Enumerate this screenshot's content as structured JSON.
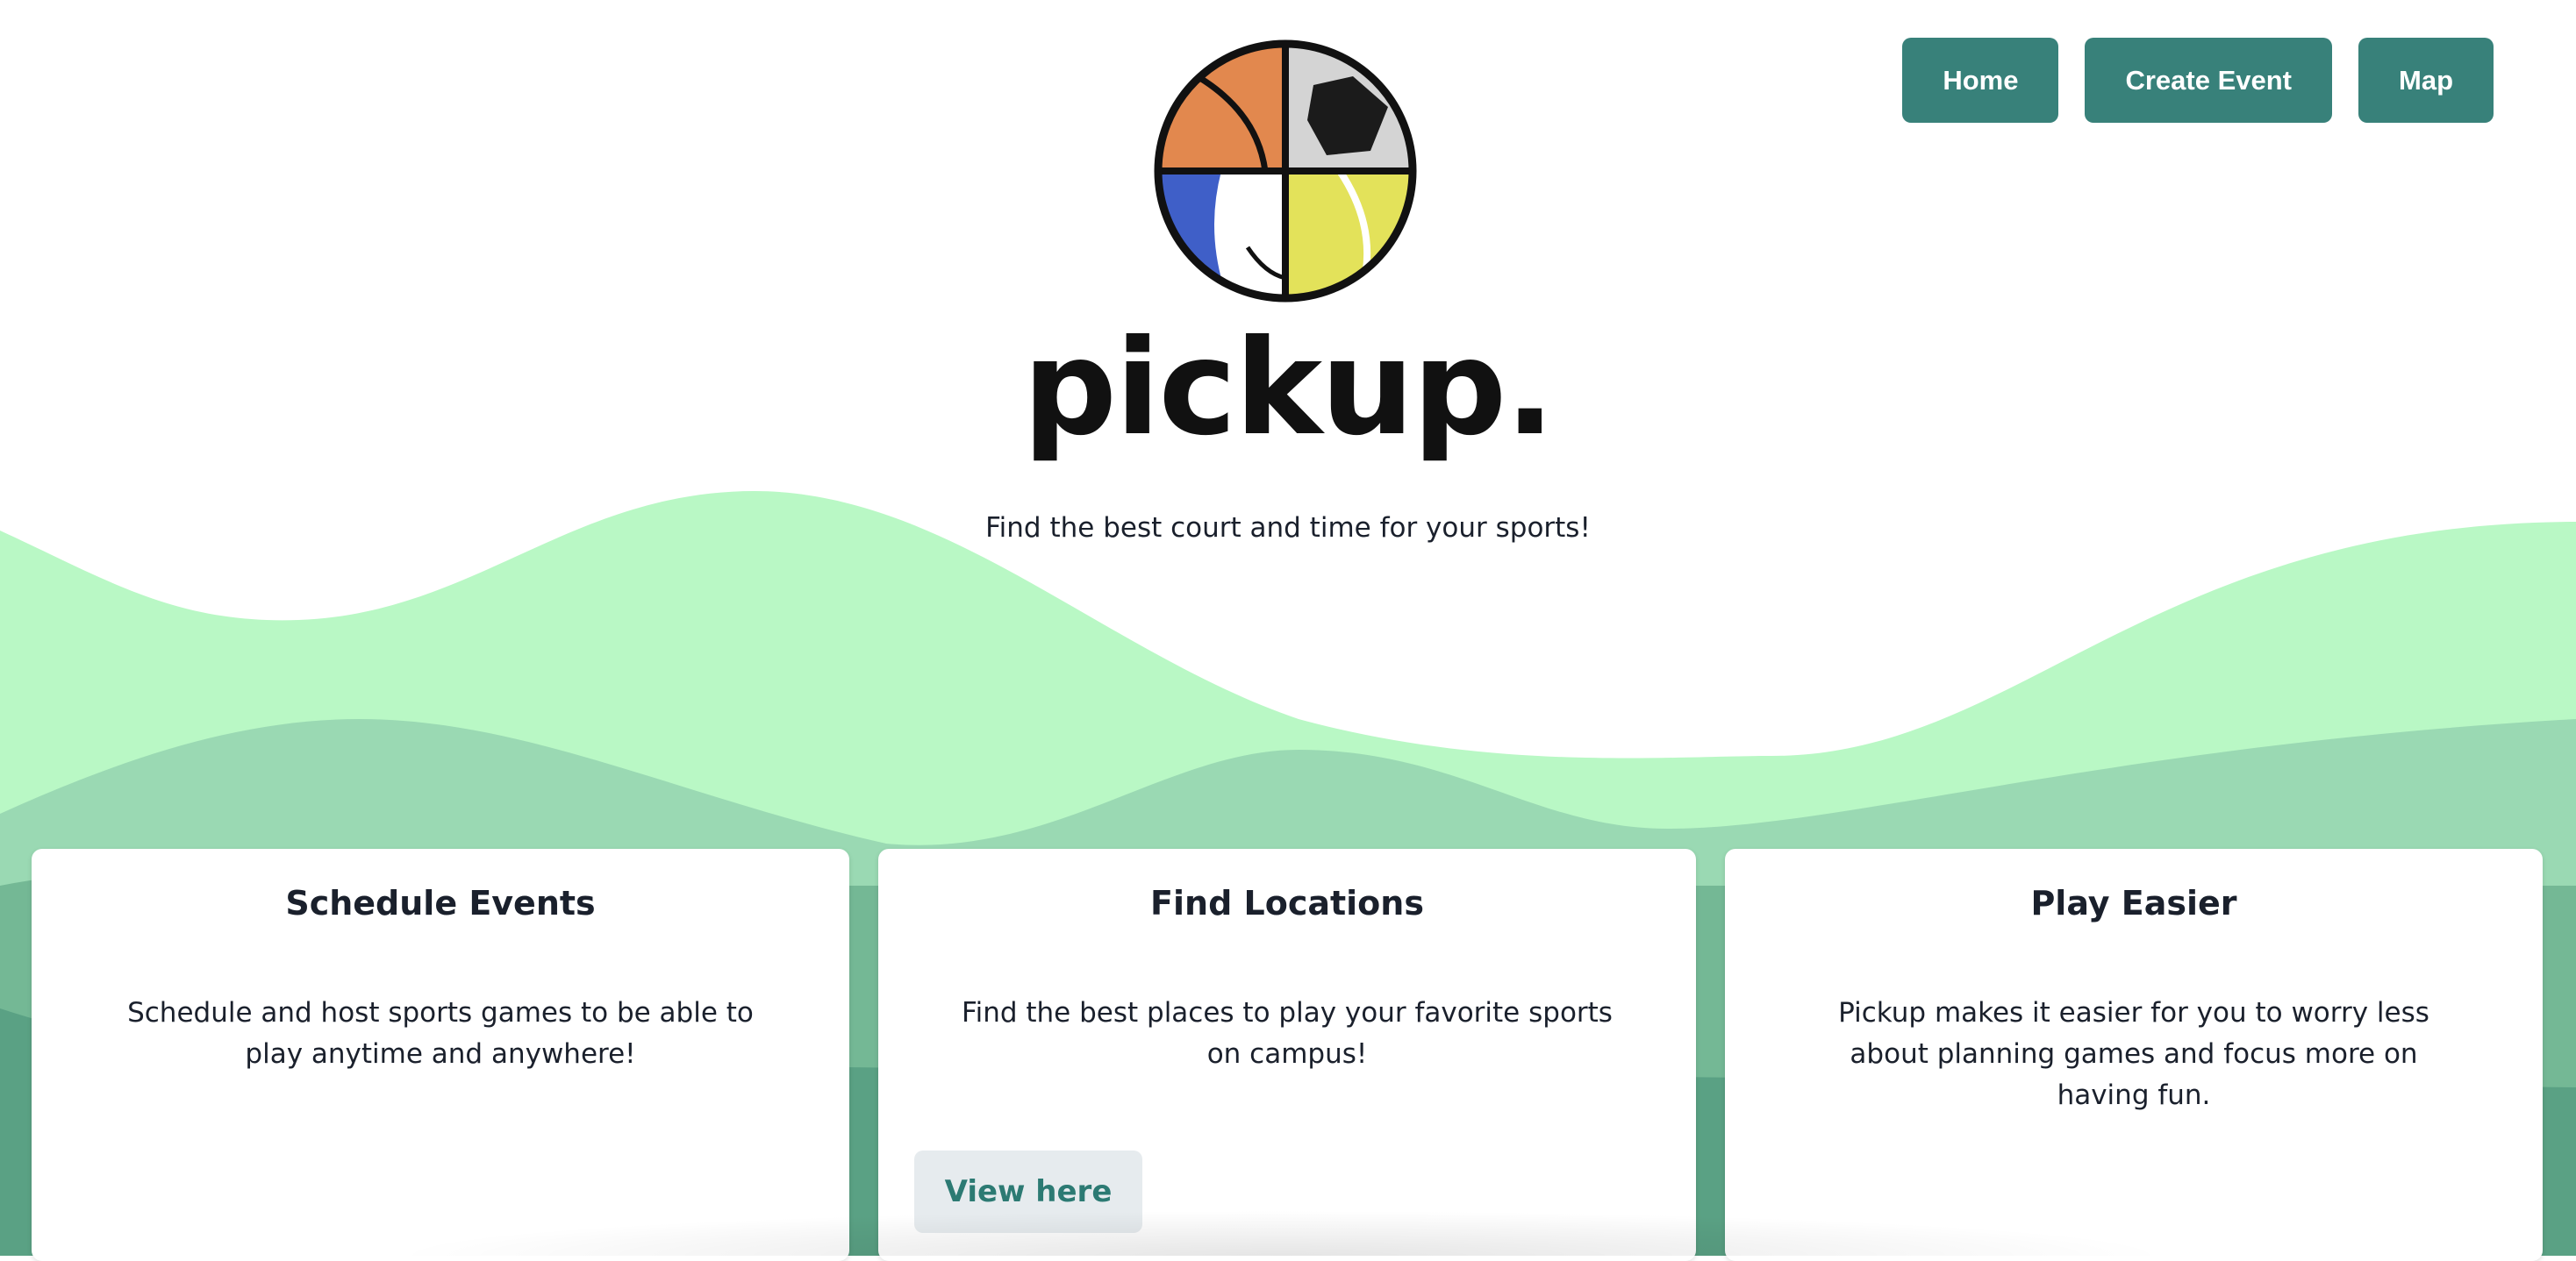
{
  "colors": {
    "accent": "#38817a",
    "wave_light": "#b9f8c5",
    "wave_mid": "#9ad9b3",
    "wave_dark": "#74b895",
    "wave_deeper": "#5aa184"
  },
  "nav": {
    "home": "Home",
    "create_event": "Create Event",
    "map": "Map"
  },
  "brand": {
    "logo_icon": "sports-balls-logo-icon",
    "wordmark": "pickup.",
    "tagline": "Find the best court and time for your sports!"
  },
  "cards": [
    {
      "title": "Schedule Events",
      "text": "Schedule and host sports games to be able to play anytime and anywhere!"
    },
    {
      "title": "Find Locations",
      "text": "Find the best places to play your favorite sports on campus!",
      "button": "View here"
    },
    {
      "title": "Play Easier",
      "text": "Pickup makes it easier for you to worry less about planning games and focus more on having fun."
    }
  ]
}
